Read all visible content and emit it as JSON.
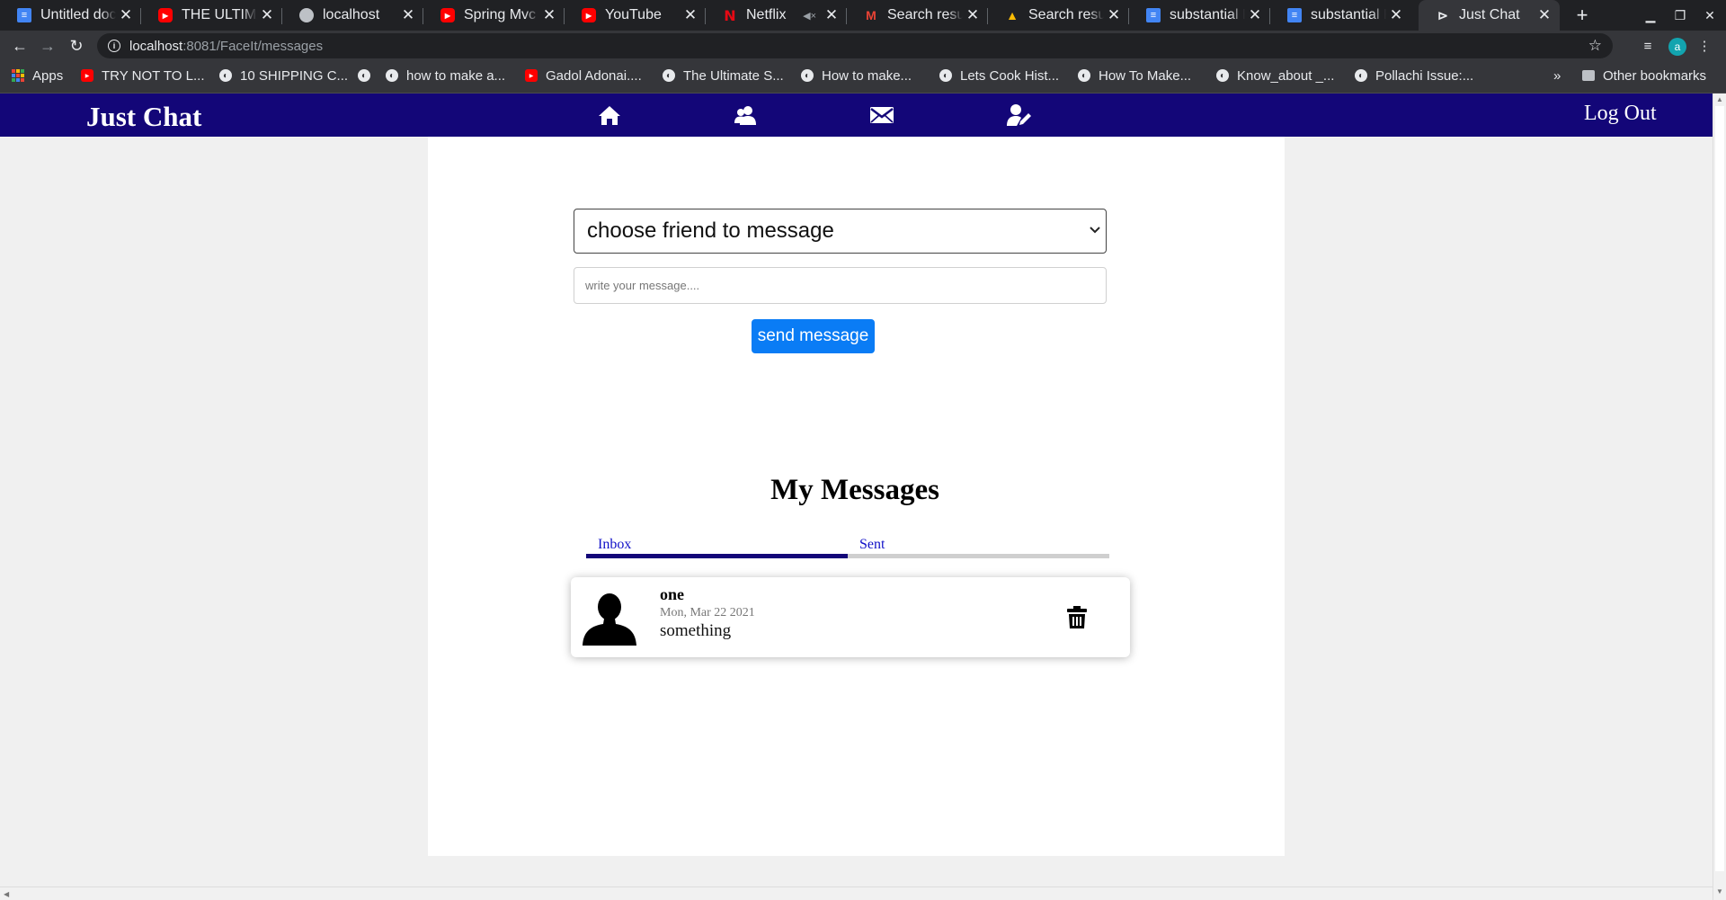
{
  "browser": {
    "tabs": [
      {
        "title": "Untitled docu",
        "favicon": "docs-icon"
      },
      {
        "title": "THE ULTIMAT",
        "favicon": "youtube-icon"
      },
      {
        "title": "localhost",
        "favicon": "globe-icon"
      },
      {
        "title": "Spring Mvc ur",
        "favicon": "youtube-icon"
      },
      {
        "title": "YouTube",
        "favicon": "youtube-icon"
      },
      {
        "title": "Netflix",
        "favicon": "netflix-icon",
        "muted": true
      },
      {
        "title": "Search result",
        "favicon": "gmail-icon"
      },
      {
        "title": "Search result",
        "favicon": "drive-icon"
      },
      {
        "title": "substantial R",
        "favicon": "docs-icon"
      },
      {
        "title": "substantial R",
        "favicon": "docs-icon"
      },
      {
        "title": "Just Chat",
        "favicon": "chat-icon",
        "active": true
      }
    ],
    "address": {
      "host": "localhost",
      "path": ":8081/FaceIt/messages"
    },
    "profile_initial": "a",
    "bookmarks": [
      {
        "label": "Apps",
        "icon": "apps-grid-icon"
      },
      {
        "label": "TRY NOT TO L...",
        "icon": "youtube-icon"
      },
      {
        "label": "10 SHIPPING C...",
        "icon": "web-icon"
      },
      {
        "label": "",
        "icon": "web-icon"
      },
      {
        "label": "how to make a...",
        "icon": "web-icon"
      },
      {
        "label": "Gadol Adonai....",
        "icon": "youtube-icon"
      },
      {
        "label": "The Ultimate S...",
        "icon": "web-icon"
      },
      {
        "label": "How to make...",
        "icon": "web-icon"
      },
      {
        "label": "Lets Cook Hist...",
        "icon": "web-icon"
      },
      {
        "label": "How To Make...",
        "icon": "web-icon"
      },
      {
        "label": "Know_about _...",
        "icon": "web-icon"
      },
      {
        "label": "Pollachi Issue:...",
        "icon": "web-icon"
      }
    ],
    "more_bookmarks": "»",
    "other_bookmarks": "Other bookmarks"
  },
  "app": {
    "brand": "Just Chat",
    "nav": [
      "home-icon",
      "friends-icon",
      "messages-icon",
      "edit-profile-icon"
    ],
    "logout_label": "Log Out",
    "colors": {
      "navbar": "#130678",
      "primary_button": "#0a7cf5",
      "tab_link": "#1010c8"
    }
  },
  "compose": {
    "friend_select_value": "choose friend to message",
    "message_placeholder": "write your message....",
    "send_label": "send message"
  },
  "messages": {
    "title": "My Messages",
    "tabs": [
      {
        "label": "Inbox",
        "active": true
      },
      {
        "label": "Sent",
        "active": false
      }
    ],
    "active_tab_fraction": 0.5,
    "items": [
      {
        "sender": "one",
        "date": "Mon, Mar 22 2021",
        "body": "something"
      }
    ]
  }
}
